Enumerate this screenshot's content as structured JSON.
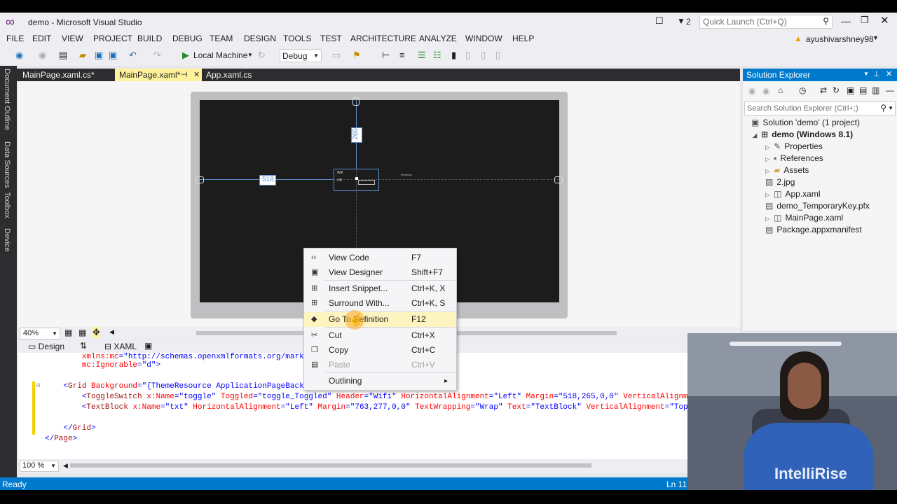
{
  "window": {
    "title": "demo - Microsoft Visual Studio",
    "quick_launch_placeholder": "Quick Launch (Ctrl+Q)",
    "notification_count": "2",
    "user": "ayushivarshney98"
  },
  "menu": [
    "FILE",
    "EDIT",
    "VIEW",
    "PROJECT",
    "BUILD",
    "DEBUG",
    "TEAM",
    "DESIGN",
    "TOOLS",
    "TEST",
    "ARCHITECTURE",
    "ANALYZE",
    "WINDOW",
    "HELP"
  ],
  "toolbar": {
    "run_target": "Local Machine",
    "config": "Debug"
  },
  "left_tabs": [
    "Document Outline",
    "Data Sources",
    "Toolbox",
    "Device"
  ],
  "doc_tabs": [
    {
      "label": "MainPage.xaml.cs*"
    },
    {
      "label": "MainPage.xaml*"
    },
    {
      "label": "App.xaml.cs"
    }
  ],
  "designer": {
    "margin_top_badge": "265",
    "margin_left_badge": "518",
    "toggle_header": "Wifi",
    "toggle_state": "Off",
    "textblock_text": "TextBlock",
    "zoom": "40%"
  },
  "split": {
    "design_label": "Design",
    "xaml_label": "XAML"
  },
  "code": [
    {
      "prefix": "        ",
      "parts": [
        [
          "a",
          "xmlns:mc"
        ],
        [
          "v",
          "=\"http://schemas.openxmlformats.org/markup-c"
        ]
      ]
    },
    {
      "prefix": "        ",
      "parts": [
        [
          "a",
          "mc:Ignorable"
        ],
        [
          "v",
          "=\"d\""
        ],
        [
          "b",
          ">"
        ]
      ]
    },
    {
      "prefix": "",
      "parts": []
    },
    {
      "prefix": "    ",
      "parts": [
        [
          "b",
          "<"
        ],
        [
          "k",
          "Grid"
        ],
        [
          "a",
          " Background"
        ],
        [
          "v",
          "=\"{ThemeResource ApplicationPageBack"
        ]
      ]
    },
    {
      "prefix": "        ",
      "parts": [
        [
          "b",
          "<"
        ],
        [
          "k",
          "ToggleSwitch"
        ],
        [
          "a",
          " x:Name"
        ],
        [
          "v",
          "=\"toggle\""
        ],
        [
          "a",
          " Toggled"
        ],
        [
          "v",
          "=\"toggle_Toggled\""
        ],
        [
          "a",
          " Header"
        ],
        [
          "v",
          "=\"Wifi\""
        ],
        [
          "a",
          " HorizontalAlignment"
        ],
        [
          "v",
          "=\"Left\""
        ],
        [
          "a",
          " Margin"
        ],
        [
          "v",
          "=\"518,265,0,0\""
        ],
        [
          "a",
          " VerticalAlignm"
        ]
      ]
    },
    {
      "prefix": "        ",
      "parts": [
        [
          "b",
          "<"
        ],
        [
          "k",
          "TextBlock"
        ],
        [
          "a",
          " x:Name"
        ],
        [
          "v",
          "=\"txt\""
        ],
        [
          "a",
          " HorizontalAlignment"
        ],
        [
          "v",
          "=\"Left\""
        ],
        [
          "a",
          " Margin"
        ],
        [
          "v",
          "=\"763,277,0,0\""
        ],
        [
          "a",
          " TextWrapping"
        ],
        [
          "v",
          "=\"Wrap\""
        ],
        [
          "a",
          " Text"
        ],
        [
          "v",
          "=\"TextBlock\""
        ],
        [
          "a",
          " VerticalAlignment"
        ],
        [
          "v",
          "=\"Top"
        ]
      ]
    },
    {
      "prefix": "",
      "parts": []
    },
    {
      "prefix": "    ",
      "parts": [
        [
          "b",
          "</"
        ],
        [
          "k",
          "Grid"
        ],
        [
          "b",
          ">"
        ]
      ]
    },
    {
      "prefix": "",
      "parts": [
        [
          "b",
          "</"
        ],
        [
          "k",
          "Page"
        ],
        [
          "b",
          ">"
        ]
      ]
    }
  ],
  "editor_zoom": "100 %",
  "status": {
    "left": "Ready",
    "right": "Ln 11"
  },
  "solution_explorer": {
    "title": "Solution Explorer",
    "search_placeholder": "Search Solution Explorer (Ctrl+;)",
    "items": [
      {
        "label": "Solution 'demo' (1 project)",
        "icon": "solution-icon"
      },
      {
        "label": "demo (Windows 8.1)",
        "icon": "csharp-project-icon"
      },
      {
        "label": "Properties",
        "icon": "wrench-icon"
      },
      {
        "label": "References",
        "icon": "references-icon"
      },
      {
        "label": "Assets",
        "icon": "folder-icon"
      },
      {
        "label": "2.jpg",
        "icon": "image-file-icon"
      },
      {
        "label": "App.xaml",
        "icon": "xaml-file-icon"
      },
      {
        "label": "demo_TemporaryKey.pfx",
        "icon": "certificate-icon"
      },
      {
        "label": "MainPage.xaml",
        "icon": "xaml-file-icon"
      },
      {
        "label": "Package.appxmanifest",
        "icon": "manifest-icon"
      }
    ]
  },
  "context_menu": [
    {
      "label": "View Code",
      "shortcut": "F7",
      "icon": "code-icon"
    },
    {
      "label": "View Designer",
      "shortcut": "Shift+F7",
      "icon": "designer-icon"
    },
    {
      "label": "Insert Snippet...",
      "shortcut": "Ctrl+K, X",
      "icon": "snippet-icon"
    },
    {
      "label": "Surround With...",
      "shortcut": "Ctrl+K, S",
      "icon": "surround-icon"
    },
    {
      "label": "Go To Definition",
      "shortcut": "F12",
      "icon": "goto-definition-icon"
    },
    {
      "label": "Cut",
      "shortcut": "Ctrl+X",
      "icon": "scissors-icon"
    },
    {
      "label": "Copy",
      "shortcut": "Ctrl+C",
      "icon": "copy-icon"
    },
    {
      "label": "Paste",
      "shortcut": "Ctrl+V",
      "icon": "paste-icon"
    },
    {
      "label": "Outlining",
      "shortcut": "",
      "icon": ""
    }
  ],
  "webcam": {
    "shirt_text": "IntelliRise"
  }
}
